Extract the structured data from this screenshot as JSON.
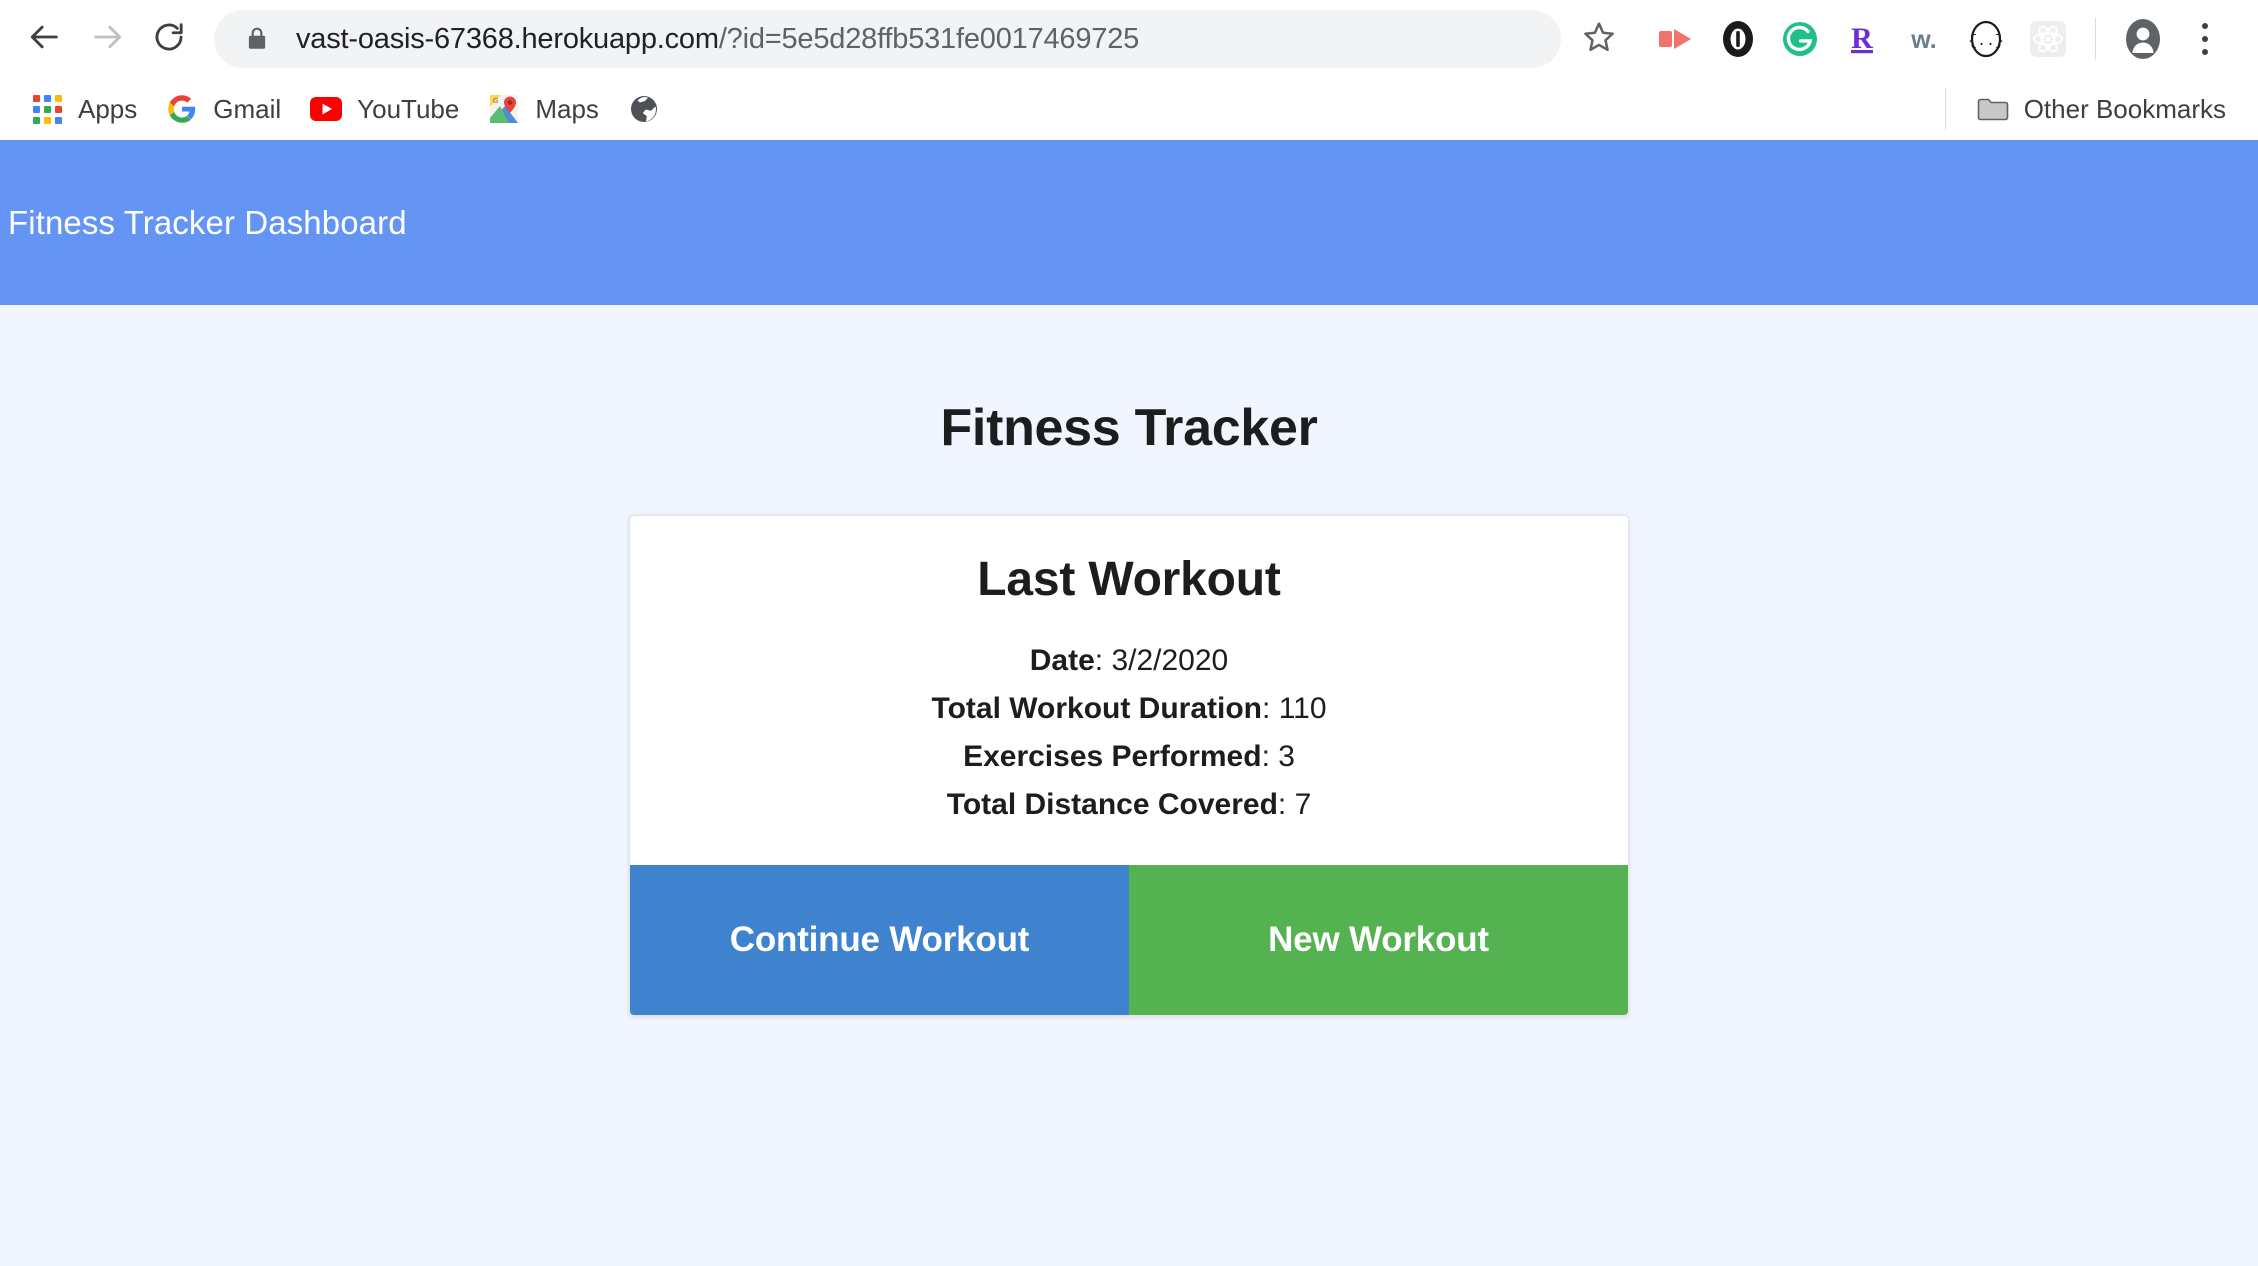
{
  "browser": {
    "back_icon": "back-arrow-icon",
    "forward_icon": "forward-arrow-icon",
    "reload_icon": "reload-icon",
    "lock_icon": "lock-icon",
    "url_domain": "vast-oasis-67368.herokuapp.com",
    "url_path": "/?id=5e5d28ffb531fe0017469725",
    "url_full": "vast-oasis-67368.herokuapp.com/?id=5e5d28ffb531fe0017469725",
    "star_icon": "bookmark-star-icon",
    "extensions": [
      {
        "name": "momentum-extension-icon",
        "glyph": ""
      },
      {
        "name": "onepassword-extension-icon",
        "glyph": ""
      },
      {
        "name": "grammarly-extension-icon",
        "glyph": "G"
      },
      {
        "name": "rakuten-extension-icon",
        "glyph": "R"
      },
      {
        "name": "wappalyzer-extension-icon",
        "glyph": "w."
      },
      {
        "name": "json-viewer-extension-icon",
        "glyph": "{..}"
      },
      {
        "name": "react-devtools-extension-icon",
        "glyph": ""
      }
    ],
    "profile_icon": "profile-avatar-icon",
    "menu_icon": "three-dot-menu-icon",
    "bookmarks": [
      {
        "label": "Apps",
        "icon": "apps-grid-icon"
      },
      {
        "label": "Gmail",
        "icon": "google-g-icon"
      },
      {
        "label": "YouTube",
        "icon": "youtube-icon"
      },
      {
        "label": "Maps",
        "icon": "google-maps-pin-icon"
      },
      {
        "label": "",
        "icon": "globe-icon"
      }
    ],
    "other_bookmarks_label": "Other Bookmarks",
    "other_bookmarks_icon": "folder-icon"
  },
  "page": {
    "header_title": "Fitness Tracker Dashboard",
    "header_color": "#6495f5",
    "background_color": "#f1f5fd",
    "title": "Fitness Tracker",
    "card": {
      "heading": "Last Workout",
      "stats": [
        {
          "label": "Date",
          "value": "3/2/2020"
        },
        {
          "label": "Total Workout Duration",
          "value": "110"
        },
        {
          "label": "Exercises Performed",
          "value": "3"
        },
        {
          "label": "Total Distance Covered",
          "value": "7"
        }
      ],
      "buttons": [
        {
          "label": "Continue Workout",
          "color": "#3f83ce"
        },
        {
          "label": "New Workout",
          "color": "#55b251"
        }
      ]
    }
  }
}
